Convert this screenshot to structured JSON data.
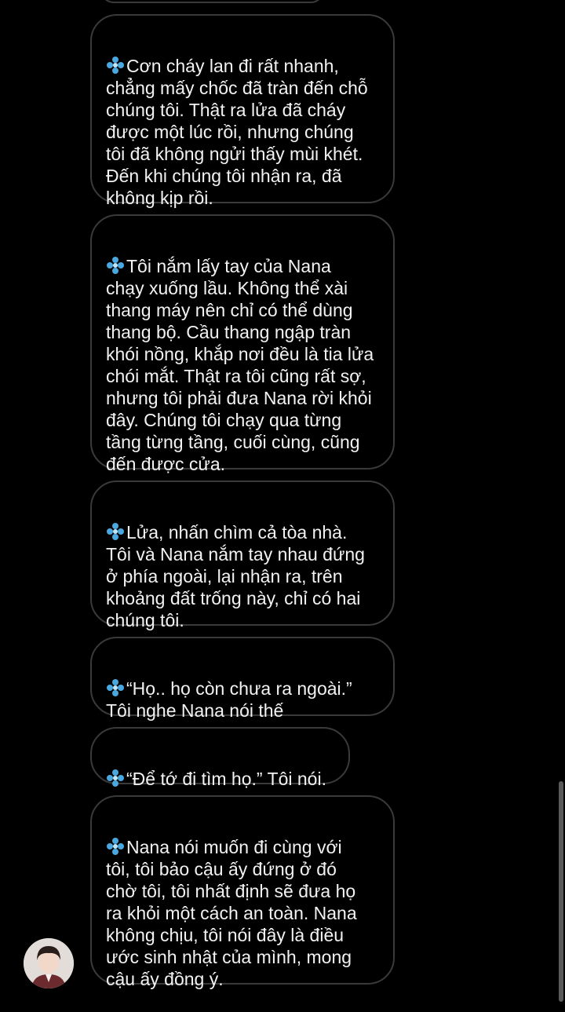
{
  "colors": {
    "background": "#000000",
    "bubble_border": "#3a3a3a",
    "text": "#f2f2f2",
    "diamond_icon": "#4aa8e0"
  },
  "messages": [
    {
      "icon": "diamond-icon",
      "text": "Cơn cháy lan đi rất nhanh, chẳng mấy chốc đã tràn đến chỗ chúng tôi. Thật ra lửa đã cháy được một lúc rồi, nhưng chúng tôi đã không ngửi thấy mùi khét. Đến khi chúng tôi nhận ra, đã không kịp rồi."
    },
    {
      "icon": "diamond-icon",
      "text": "Tôi nắm lấy tay của Nana chạy xuống lầu. Không thể xài thang máy nên chỉ có thể dùng thang bộ. Cầu thang ngập tràn khói nồng, khắp nơi đều là tia lửa chói mắt. Thật ra tôi cũng rất sợ, nhưng tôi phải đưa Nana rời khỏi đây. Chúng tôi chạy qua từng tầng từng tầng, cuối cùng, cũng đến được cửa."
    },
    {
      "icon": "diamond-icon",
      "text": "Lửa, nhấn chìm cả tòa nhà. Tôi và Nana nắm tay nhau đứng ở phía ngoài, lại nhận ra, trên khoảng đất trống này, chỉ có hai chúng tôi."
    },
    {
      "icon": "diamond-icon",
      "text": "“Họ.. họ còn chưa ra ngoài.” Tôi nghe Nana nói thế"
    },
    {
      "icon": "diamond-icon",
      "text": "“Để tớ đi tìm họ.” Tôi nói."
    },
    {
      "icon": "diamond-icon",
      "text": "Nana nói muốn đi cùng với tôi, tôi bảo cậu ấy đứng ở đó chờ tôi, tôi nhất định sẽ đưa họ ra khỏi một cách an toàn. Nana không chịu, tôi nói đây là điều ước sinh nhật của mình, mong cậu ấy đồng ý."
    }
  ],
  "lines": {
    "m0": [
      "Cơn cháy lan đi rất nhanh,",
      "chẳng mấy chốc đã tràn đến chỗ",
      "chúng tôi. Thật ra lửa đã cháy",
      "được một lúc rồi, nhưng chúng",
      "tôi đã không ngửi thấy mùi khét.",
      "Đến khi chúng tôi nhận ra, đã",
      "không kịp rồi."
    ],
    "m1": [
      "Tôi nắm lấy tay của Nana",
      "chạy xuống lầu. Không thể xài",
      "thang máy nên chỉ có thể dùng",
      "thang bộ. Cầu thang ngập tràn",
      "khói nồng, khắp nơi đều là tia lửa",
      "chói mắt. Thật ra tôi cũng rất sợ,",
      "nhưng tôi phải đưa Nana rời khỏi",
      "đây. Chúng tôi chạy qua từng",
      "tầng từng tầng, cuối cùng, cũng",
      "đến được cửa."
    ],
    "m2": [
      "Lửa, nhấn chìm cả tòa nhà.",
      "Tôi và Nana nắm tay nhau đứng",
      "ở phía ngoài, lại nhận ra, trên",
      "khoảng đất trống này, chỉ có hai",
      "chúng tôi."
    ],
    "m3": [
      "“Họ.. họ còn chưa ra ngoài.”",
      "Tôi nghe Nana nói thế"
    ],
    "m4": [
      "“Để tớ đi tìm họ.” Tôi nói."
    ],
    "m5": [
      "Nana nói muốn đi cùng với",
      "tôi, tôi bảo cậu ấy đứng ở đó",
      "chờ tôi, tôi nhất định sẽ đưa họ",
      "ra khỏi một cách an toàn. Nana",
      "không chịu, tôi nói đây là điều",
      "ước sinh nhật của mình, mong",
      "cậu ấy đồng ý."
    ]
  }
}
